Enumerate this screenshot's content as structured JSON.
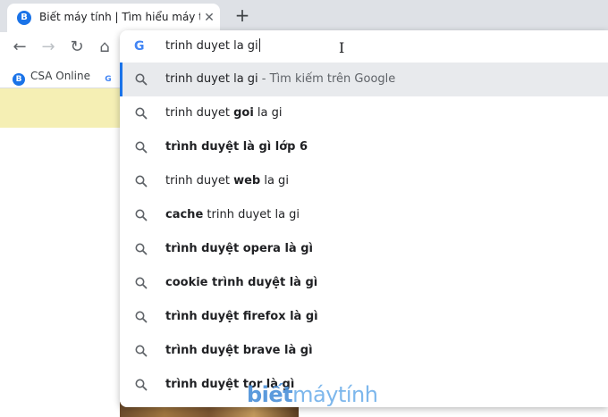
{
  "tab": {
    "favicon_letter": "B",
    "title": "Biết máy tính | Tìm hiểu máy tính",
    "close_glyph": "✕",
    "new_tab_glyph": "+"
  },
  "toolbar": {
    "back_glyph": "←",
    "forward_glyph": "→",
    "reload_glyph": "↻",
    "home_glyph": "⌂"
  },
  "bookmarks": [
    {
      "favicon_letter": "B",
      "label": "CSA Online"
    },
    {
      "favicon_letter": "G",
      "label": ""
    }
  ],
  "omnibox": {
    "engine_icon": "G",
    "value": "trinh duyet la gi",
    "ibeam": "I"
  },
  "suggestions": [
    {
      "parts": [
        {
          "t": "trinh duyet la gi",
          "b": false
        }
      ],
      "suffix": " - Tìm kiếm trên Google",
      "selected": true
    },
    {
      "parts": [
        {
          "t": "trinh duyet ",
          "b": false
        },
        {
          "t": "goi",
          "b": true
        },
        {
          "t": " la gi",
          "b": false
        }
      ],
      "suffix": "",
      "selected": false
    },
    {
      "parts": [
        {
          "t": "trình duyệt là gì lớp 6",
          "b": true
        }
      ],
      "suffix": "",
      "selected": false
    },
    {
      "parts": [
        {
          "t": "trinh duyet ",
          "b": false
        },
        {
          "t": "web",
          "b": true
        },
        {
          "t": " la gi",
          "b": false
        }
      ],
      "suffix": "",
      "selected": false
    },
    {
      "parts": [
        {
          "t": "cache",
          "b": true
        },
        {
          "t": " trinh duyet la gi",
          "b": false
        }
      ],
      "suffix": "",
      "selected": false
    },
    {
      "parts": [
        {
          "t": "trình duyệt opera là gì",
          "b": true
        }
      ],
      "suffix": "",
      "selected": false
    },
    {
      "parts": [
        {
          "t": "cookie trình duyệt là gì",
          "b": true
        }
      ],
      "suffix": "",
      "selected": false
    },
    {
      "parts": [
        {
          "t": "trình duyệt firefox là gì",
          "b": true
        }
      ],
      "suffix": "",
      "selected": false
    },
    {
      "parts": [
        {
          "t": "trình duyệt brave là gì",
          "b": true
        }
      ],
      "suffix": "",
      "selected": false
    },
    {
      "parts": [
        {
          "t": "trình duyệt tor là gì",
          "b": true
        }
      ],
      "suffix": "",
      "selected": false
    }
  ],
  "watermark": {
    "bold": "biết",
    "light": "máytính"
  },
  "colors": {
    "accent": "#1a73e8",
    "selected_bg": "#e8eaed",
    "banner": "#f5efb4"
  }
}
